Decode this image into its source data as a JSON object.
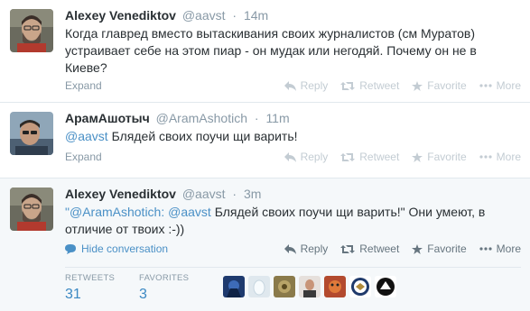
{
  "tweets": [
    {
      "fullname": "Alexey Venediktov",
      "username": "@aavst",
      "dot": "·",
      "time": "14m",
      "text": "Когда главред вместо вытаскивания своих журналистов (см Муратов) устраивает себе на этом пиар - он мудак или негодяй. Почему он не в Киеве?",
      "expand": "Expand",
      "actions": [
        "Reply",
        "Retweet",
        "Favorite",
        "More"
      ]
    },
    {
      "fullname": "АрамАшотыч",
      "username": "@AramAshotich",
      "dot": "·",
      "time": "11m",
      "mention": "@aavst",
      "text_rest": " Блядей своих поучи щи варить!",
      "expand": "Expand",
      "actions": [
        "Reply",
        "Retweet",
        "Favorite",
        "More"
      ]
    },
    {
      "fullname": "Alexey Venediktov",
      "username": "@aavst",
      "dot": "·",
      "time": "3m",
      "quote_open": "\"",
      "mention1": "@AramAshotich",
      "colon": ": ",
      "mention2": "@aavst",
      "text_rest": " Блядей своих поучи щи варить!\" Они умеют, в отличие от твоих :-))",
      "hide_conversation": "Hide conversation",
      "actions": [
        "Reply",
        "Retweet",
        "Favorite",
        "More"
      ]
    }
  ],
  "stats": {
    "retweets_label": "RETWEETS",
    "retweets_value": "31",
    "favorites_label": "FAVORITES",
    "favorites_value": "3"
  },
  "colors": {
    "link": "#4a90c6",
    "muted": "#8899a6",
    "action_inactive": "#c3ccd3",
    "focused_bg": "#f5f8fa"
  }
}
